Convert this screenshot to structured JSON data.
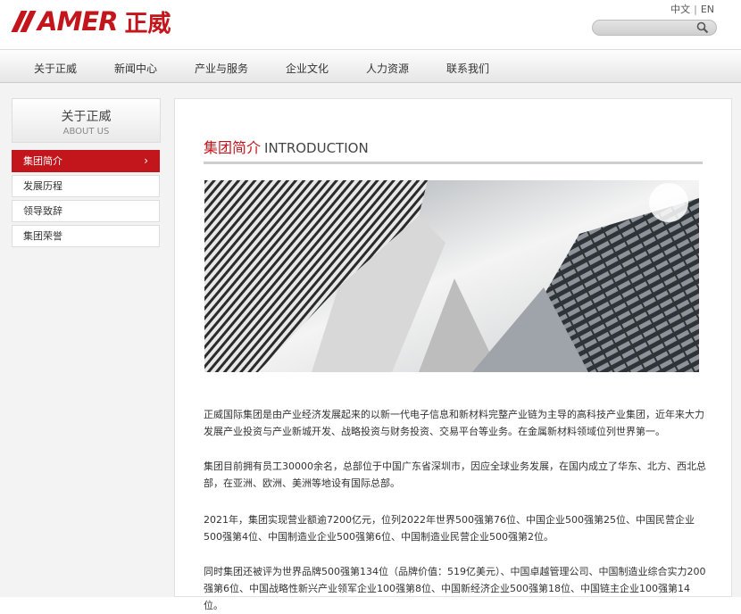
{
  "header": {
    "logo_text": "AMER",
    "logo_cn": "正威",
    "lang_cn": "中文",
    "lang_sep": "|",
    "lang_en": "EN"
  },
  "nav": [
    "关于正威",
    "新闻中心",
    "产业与服务",
    "企业文化",
    "人力资源",
    "联系我们"
  ],
  "sidebar": {
    "title": "关于正威",
    "subtitle": "ABOUT US",
    "items": [
      {
        "label": "集团简介",
        "chevron": "›"
      },
      {
        "label": "发展历程"
      },
      {
        "label": "领导致辞"
      },
      {
        "label": "集团荣誉"
      }
    ]
  },
  "main": {
    "title_cn": "集团简介",
    "title_en": "INTRODUCTION",
    "paragraphs": [
      "正威国际集团是由产业经济发展起来的以新一代电子信息和新材料完整产业链为主导的高科技产业集团，近年来大力发展产业投资与产业新城开发、战略投资与财务投资、交易平台等业务。在金属新材料领域位列世界第一。",
      "集团目前拥有员工30000余名，总部位于中国广东省深圳市，因应全球业务发展，在国内成立了华东、北方、西北总部，在亚洲、欧洲、美洲等地设有国际总部。",
      "2021年，集团实现营业额逾7200亿元，位列2022年世界500强第76位、中国企业500强第25位、中国民营企业500强第4位、中国制造业企业500强第6位、中国制造业民营企业500强第2位。",
      "同时集团还被评为世界品牌500强第134位（品牌价值：519亿美元）、中国卓越管理公司、中国制造业综合实力200强第6位、中国战略性新兴产业领军企业100强第8位、中国新经济企业500强第18位、中国链主企业100强第14位。"
    ]
  },
  "colors": {
    "brand": "#c3161c",
    "background": "#f3f3f3"
  }
}
